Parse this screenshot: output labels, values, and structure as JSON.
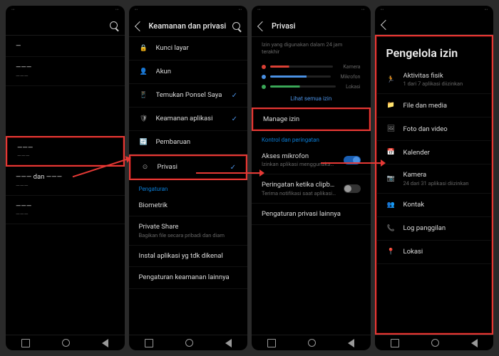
{
  "screen1": {
    "header": "",
    "items": [
      {
        "title": "—",
        "sub": ""
      },
      {
        "title": "———",
        "sub": "———"
      },
      {
        "title": "",
        "sub": ""
      }
    ],
    "highlight_item": {
      "title": "———",
      "sub": "———"
    },
    "below": [
      {
        "title": "——— dan ———",
        "sub": "———"
      },
      {
        "title": "———",
        "sub": "———"
      }
    ]
  },
  "screen2": {
    "header": "Keamanan dan privasi",
    "items": [
      {
        "icon": "lock",
        "title": "Kunci layar",
        "check": false
      },
      {
        "icon": "user",
        "title": "Akun",
        "check": false
      },
      {
        "icon": "search-phone",
        "title": "Temukan Ponsel Saya",
        "check": true
      },
      {
        "icon": "shield",
        "title": "Keamanan aplikasi",
        "check": true
      },
      {
        "icon": "update",
        "title": "Pembaruan",
        "check": false
      },
      {
        "icon": "privacy",
        "title": "Privasi",
        "check": true,
        "highlight": true
      }
    ],
    "section2": "Pengaturan",
    "items2": [
      {
        "title": "Biometrik",
        "sub": ""
      },
      {
        "title": "Private Share",
        "sub": "Bagikan file secara pribadi dan diam"
      },
      {
        "title": "Instal aplikasi yg tdk dikenal",
        "sub": ""
      },
      {
        "title": "Pengaturan keamanan lainnya",
        "sub": ""
      }
    ]
  },
  "screen3": {
    "header": "Privasi",
    "desc": "Izin yang digunakan dalam 24 jam terakhir",
    "usage": [
      {
        "color": "#d94035",
        "len": 30,
        "label": "Kamera"
      },
      {
        "color": "#4a90e2",
        "len": 60,
        "label": "Mikrofon"
      },
      {
        "color": "#3aa757",
        "len": 45,
        "label": "Lokasi"
      }
    ],
    "link": "Lihat semua izin",
    "manage": {
      "title": "Manage izin",
      "highlight": true
    },
    "section2": "Kontrol dan peringatan",
    "toggles": [
      {
        "title": "Akses mikrofon",
        "sub": "Izinkan aplikasi menggunakan mikrofon saat diizinkan",
        "on": true
      },
      {
        "title": "Peringatan ketika clipboard diakses",
        "sub": "Terima notifikasi saat aplikasi mengakses teks atau gambar",
        "on": false
      }
    ],
    "more": "Pengaturan privasi lainnya"
  },
  "screen4": {
    "big_title": "Pengelola izin",
    "items": [
      {
        "icon": "activity",
        "title": "Aktivitas fisik",
        "sub": "1 dari 7 aplikasi diizinkan"
      },
      {
        "icon": "files",
        "title": "File dan media",
        "sub": ""
      },
      {
        "icon": "photos",
        "title": "Foto dan video",
        "sub": ""
      },
      {
        "icon": "calendar",
        "title": "Kalender",
        "sub": ""
      },
      {
        "icon": "camera",
        "title": "Kamera",
        "sub": "24 dari 31 aplikasi diizinkan"
      },
      {
        "icon": "contacts",
        "title": "Kontak",
        "sub": ""
      },
      {
        "icon": "calllog",
        "title": "Log panggilan",
        "sub": ""
      },
      {
        "icon": "location",
        "title": "Lokasi",
        "sub": ""
      }
    ]
  }
}
